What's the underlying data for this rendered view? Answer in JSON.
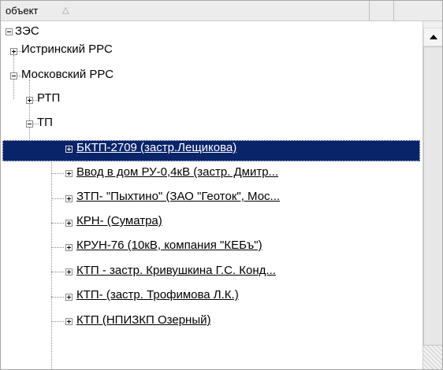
{
  "header": {
    "column_title": "объект",
    "sort_icon": "sort-ascending-icon"
  },
  "tree": {
    "root": {
      "label": "ЗЭС",
      "state": "expanded"
    },
    "level1": [
      {
        "label": "Истринский РРС",
        "state": "collapsed"
      },
      {
        "label": "Московский РРС",
        "state": "expanded"
      }
    ],
    "level2": [
      {
        "label": "РТП",
        "state": "collapsed"
      },
      {
        "label": "ТП",
        "state": "expanded"
      }
    ],
    "items": [
      {
        "label": "БКТП-2709 (застр.Лещикова)",
        "selected": true
      },
      {
        "label": "Ввод в дом РУ-0,4кВ (застр. Дмитр..."
      },
      {
        "label": "ЗТП- \"Пыхтино\" (ЗАО \"Геоток\", Мос..."
      },
      {
        "label": "КРН- (Суматра)"
      },
      {
        "label": "КРУН-76 (10кВ, компания \"КЕБъ\")"
      },
      {
        "label": "КТП - застр. Кривушкина Г.С. Конд..."
      },
      {
        "label": "КТП- (застр. Трофимова Л.К.)"
      },
      {
        "label": "КТП (НПИЗКП Озерный)"
      }
    ]
  },
  "colors": {
    "selection_bg": "#0a246a",
    "selection_text": "#ffffff",
    "header_bg": "#ececec"
  }
}
